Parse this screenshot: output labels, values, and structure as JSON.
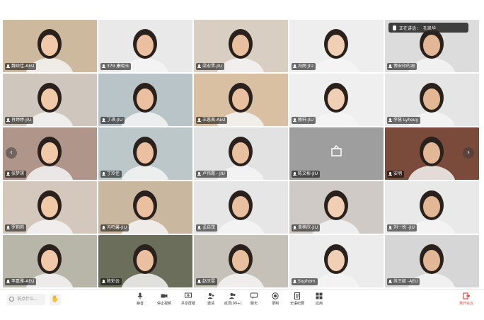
{
  "speaking_indicator": {
    "prefix": "正在讲话：",
    "name": "孔凯华"
  },
  "participants": [
    {
      "name": "魏琼佳-AEU"
    },
    {
      "name": "379 康晓玉"
    },
    {
      "name": "梁宏晋-JIU"
    },
    {
      "name": "冯雨 JIU"
    },
    {
      "name": "博安印的洞"
    },
    {
      "name": "肖婷婷-JIU"
    },
    {
      "name": "丁琪-JIU"
    },
    {
      "name": "王惠夷-AEU"
    },
    {
      "name": "赖轩-JIU"
    },
    {
      "name": "李慧 Lyhouy"
    },
    {
      "name": "张梦琪"
    },
    {
      "name": "丁玲佳"
    },
    {
      "name": "卢伟霞 - JIU"
    },
    {
      "name": "陈文彬-JIU"
    },
    {
      "name": "安明"
    },
    {
      "name": "罗莉莉"
    },
    {
      "name": "冯鸣馨-JIU"
    },
    {
      "name": "孟启茂"
    },
    {
      "name": "黄楠欣-JIU"
    },
    {
      "name": "刘一悦 -JIU"
    },
    {
      "name": "李嘉雅-AEU"
    },
    {
      "name": "陈彩云"
    },
    {
      "name": "赵庆雯"
    },
    {
      "name": "Sophom"
    },
    {
      "name": "苏王妮 -AEU"
    }
  ],
  "toolbar": {
    "chat_placeholder": "说点什么...",
    "hand_icon": "hand-icon",
    "buttons": [
      {
        "label": "静音",
        "icon": "mic-icon"
      },
      {
        "label": "停止视频",
        "icon": "camera-icon"
      },
      {
        "label": "共享屏幕",
        "icon": "share-screen-icon"
      },
      {
        "label": "邀请",
        "icon": "invite-icon"
      },
      {
        "label": "成员(99+)",
        "icon": "members-icon"
      },
      {
        "label": "聊天",
        "icon": "chat-icon"
      },
      {
        "label": "录制",
        "icon": "record-icon"
      },
      {
        "label": "无语纪要",
        "icon": "notes-icon"
      },
      {
        "label": "应用",
        "icon": "apps-icon"
      }
    ],
    "leave_label": "离开会议"
  },
  "colors": {
    "accent": "#e04b3a",
    "tile_bg": "#e8e8e8",
    "placeholder_tile": "#9e9e9e"
  }
}
